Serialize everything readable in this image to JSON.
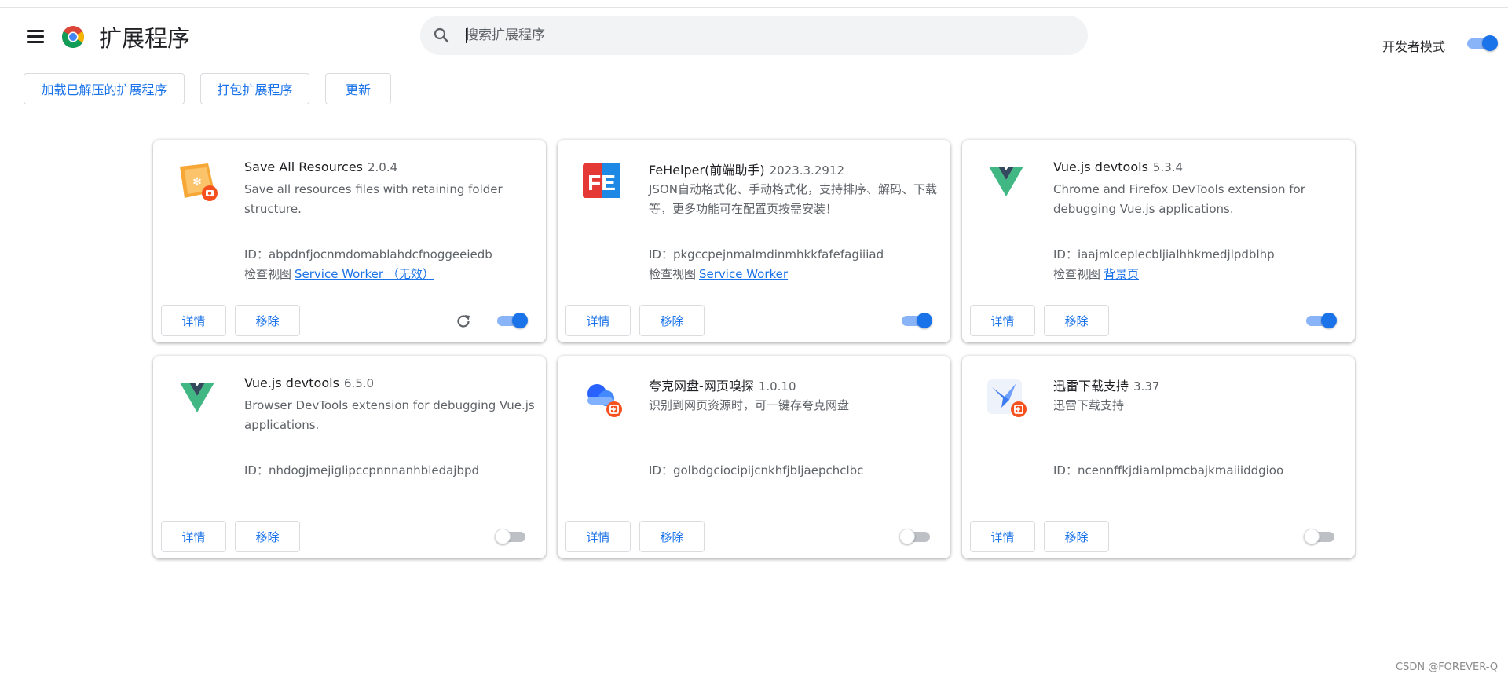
{
  "header": {
    "title": "扩展程序",
    "search_placeholder": "搜索扩展程序",
    "dev_mode_label": "开发者模式",
    "dev_mode_on": true
  },
  "toolbar": {
    "load_unpacked": "加载已解压的扩展程序",
    "pack": "打包扩展程序",
    "update": "更新"
  },
  "extensions": [
    {
      "name": "Save All Resources",
      "version": "2.0.4",
      "description": "Save all resources files with retaining folder structure.",
      "id": "ID：abpdnfjocnmdomablahdcfnoggeeiedb",
      "inspect_label": "检查视图",
      "inspect_link": "Service Worker （无效）",
      "details_label": "详情",
      "remove_label": "移除",
      "enabled": true,
      "icon": "save-all-resources-icon"
    },
    {
      "name": "FeHelper(前端助手)",
      "version": "2023.3.2912",
      "description": "JSON自动格式化、手动格式化，支持排序、解码、下载等，更多功能可在配置页按需安装！",
      "id": "ID：pkgccpejnmalmdinmhkkfafefagiiiad",
      "inspect_label": "检查视图",
      "inspect_link": "Service Worker",
      "details_label": "详情",
      "remove_label": "移除",
      "enabled": true,
      "icon": "fehelper-icon",
      "icon_text": "FE"
    },
    {
      "name": "Vue.js devtools",
      "version": "5.3.4",
      "description": "Chrome and Firefox DevTools extension for debugging Vue.js applications.",
      "id": "ID：iaajmlceplecbljialhhkmedjlpdblhp",
      "inspect_label": "检查视图",
      "inspect_link": "背景页",
      "details_label": "详情",
      "remove_label": "移除",
      "enabled": true,
      "icon": "vue-icon"
    },
    {
      "name": "Vue.js devtools",
      "version": "6.5.0",
      "description": "Browser DevTools extension for debugging Vue.js applications.",
      "id": "ID：nhdogjmejiglipccpnnnanhbledajbpd",
      "details_label": "详情",
      "remove_label": "移除",
      "enabled": false,
      "icon": "vue-icon"
    },
    {
      "name": "夸克网盘-网页嗅探",
      "version": "1.0.10",
      "description": "识别到网页资源时，可一键存夸克网盘",
      "id": "ID：golbdgciocipijcnkhfjbljaepchclbc",
      "details_label": "详情",
      "remove_label": "移除",
      "enabled": false,
      "icon": "quark-cloud-icon"
    },
    {
      "name": "迅雷下载支持",
      "version": "3.37",
      "description": "迅雷下载支持",
      "id": "ID：ncennffkjdiamlpmcbajkmaiiiddgioo",
      "details_label": "详情",
      "remove_label": "移除",
      "enabled": false,
      "icon": "xunlei-bird-icon"
    }
  ],
  "watermark": "CSDN @FOREVER-Q",
  "colors": {
    "accent": "#1a73e8",
    "toggle_track_on": "#8ab4f8",
    "vue_green": "#41b883",
    "vue_dark": "#34495e",
    "fe_red": "#e53935",
    "badge_red": "#f4511e"
  }
}
